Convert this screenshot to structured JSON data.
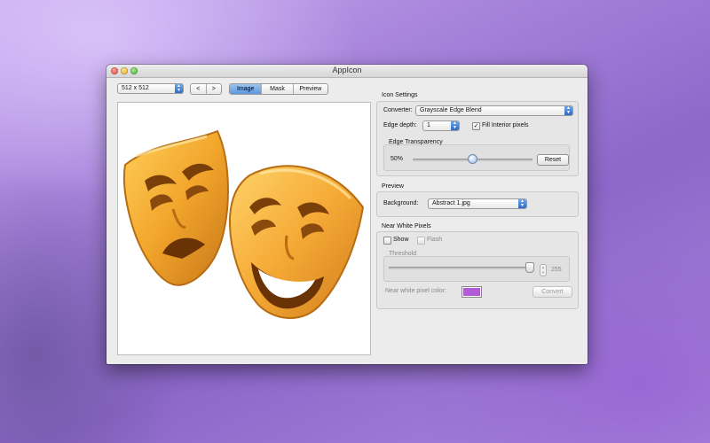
{
  "window": {
    "title": "AppIcon"
  },
  "toolbar": {
    "size_popup": "512 x 512",
    "prev_label": "<",
    "next_label": ">",
    "tabs": [
      "Image",
      "Mask",
      "Preview"
    ],
    "active_tab": "Image"
  },
  "canvas": {
    "image": "theater-masks-icon"
  },
  "icon_settings": {
    "title": "Icon Settings",
    "converter_label": "Converter:",
    "converter_value": "Grayscale Edge Blend",
    "edge_depth_label": "Edge depth:",
    "edge_depth_value": "1",
    "fill_interior_label": "Fill Interior pixels",
    "fill_interior_checked": true,
    "edge_transparency_title": "Edge Transparency",
    "transparency_value": "50%",
    "transparency_level": 0.5,
    "reset_label": "Reset"
  },
  "preview": {
    "title": "Preview",
    "background_label": "Background:",
    "background_value": "Abstract 1.jpg"
  },
  "near_white": {
    "title": "Near White Pixels",
    "show_label": "Show",
    "show_checked": false,
    "flash_label": "Flash",
    "flash_checked": false,
    "threshold_title": "Threshold",
    "threshold_value": "255",
    "threshold_level": 1.0,
    "color_label": "Near white pixel color:",
    "color_value": "#b25bd6",
    "convert_label": "Convert"
  }
}
